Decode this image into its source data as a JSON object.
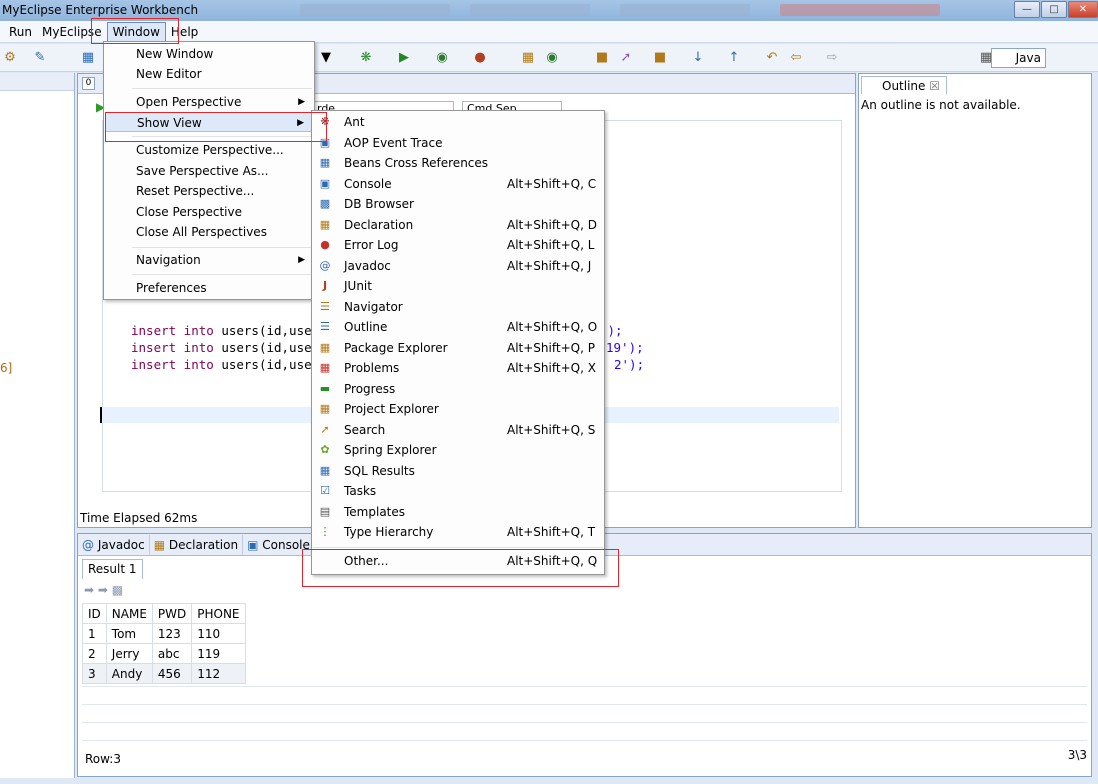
{
  "window": {
    "title": "MyEclipse Enterprise Workbench"
  },
  "menubar": {
    "items": [
      "Run",
      "MyEclipse",
      "Window",
      "Help"
    ]
  },
  "toolbar": {
    "perspective_label": "Java"
  },
  "editor": {
    "code_lines": [
      {
        "kw": "insert into",
        "rest": " users(id,use",
        "tail": "');"
      },
      {
        "kw": "insert into",
        "rest": " users(id,use",
        "tail": "19');"
      },
      {
        "kw": "insert into",
        "rest": " users(id,use",
        "tail": "2');"
      }
    ],
    "status": "Time Elapsed 62ms",
    "partial_combo1": "rde",
    "partial_combo2": "Cmd Sep"
  },
  "left_pane": {
    "partial_text": "6]"
  },
  "outline": {
    "tab_label": "Outline",
    "message": "An outline is not available."
  },
  "bottom": {
    "tabs": [
      "Javadoc",
      "Declaration",
      "Console"
    ],
    "result_tab": "Result 1",
    "columns": [
      "ID",
      "NAME",
      "PWD",
      "PHONE"
    ],
    "rows": [
      [
        "1",
        "Tom",
        "123",
        "110"
      ],
      [
        "2",
        "Jerry",
        "abc",
        "119"
      ],
      [
        "3",
        "Andy",
        "456",
        "112"
      ]
    ],
    "row_status": "Row:3",
    "page_status": "3\\3"
  },
  "window_menu": {
    "items": [
      "New Window",
      "New Editor",
      "Open Perspective",
      "Show View",
      "Customize Perspective...",
      "Save Perspective As...",
      "Reset Perspective...",
      "Close Perspective",
      "Close All Perspectives",
      "Navigation",
      "Preferences"
    ]
  },
  "show_view_menu": {
    "items": [
      {
        "label": "Ant",
        "shortcut": "",
        "icon": "ant-icon"
      },
      {
        "label": "AOP Event Trace",
        "shortcut": "",
        "icon": "aop-icon"
      },
      {
        "label": "Beans Cross References",
        "shortcut": "",
        "icon": "beans-icon"
      },
      {
        "label": "Console",
        "shortcut": "Alt+Shift+Q, C",
        "icon": "console-icon"
      },
      {
        "label": "DB Browser",
        "shortcut": "",
        "icon": "db-icon"
      },
      {
        "label": "Declaration",
        "shortcut": "Alt+Shift+Q, D",
        "icon": "declaration-icon"
      },
      {
        "label": "Error Log",
        "shortcut": "Alt+Shift+Q, L",
        "icon": "error-log-icon"
      },
      {
        "label": "Javadoc",
        "shortcut": "Alt+Shift+Q, J",
        "icon": "javadoc-icon"
      },
      {
        "label": "JUnit",
        "shortcut": "",
        "icon": "junit-icon"
      },
      {
        "label": "Navigator",
        "shortcut": "",
        "icon": "navigator-icon"
      },
      {
        "label": "Outline",
        "shortcut": "Alt+Shift+Q, O",
        "icon": "outline-icon"
      },
      {
        "label": "Package Explorer",
        "shortcut": "Alt+Shift+Q, P",
        "icon": "package-icon"
      },
      {
        "label": "Problems",
        "shortcut": "Alt+Shift+Q, X",
        "icon": "problems-icon"
      },
      {
        "label": "Progress",
        "shortcut": "",
        "icon": "progress-icon"
      },
      {
        "label": "Project Explorer",
        "shortcut": "",
        "icon": "project-icon"
      },
      {
        "label": "Search",
        "shortcut": "Alt+Shift+Q, S",
        "icon": "search-icon"
      },
      {
        "label": "Spring Explorer",
        "shortcut": "",
        "icon": "spring-icon"
      },
      {
        "label": "SQL Results",
        "shortcut": "",
        "icon": "sql-icon"
      },
      {
        "label": "Tasks",
        "shortcut": "",
        "icon": "tasks-icon"
      },
      {
        "label": "Templates",
        "shortcut": "",
        "icon": "templates-icon"
      },
      {
        "label": "Type Hierarchy",
        "shortcut": "Alt+Shift+Q, T",
        "icon": "hierarchy-icon"
      },
      {
        "label": "Other...",
        "shortcut": "Alt+Shift+Q, Q",
        "icon": ""
      }
    ]
  }
}
